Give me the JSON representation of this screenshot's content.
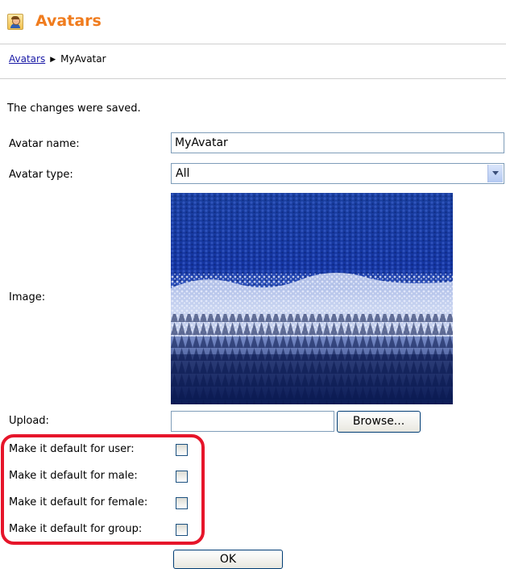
{
  "header": {
    "title": "Avatars",
    "icon": "avatar-icon"
  },
  "breadcrumb": {
    "root": "Avatars",
    "current": "MyAvatar"
  },
  "message": "The changes were saved.",
  "form": {
    "name_label": "Avatar name:",
    "name_value": "MyAvatar",
    "type_label": "Avatar type:",
    "type_value": "All",
    "image_label": "Image:",
    "upload_label": "Upload:",
    "upload_value": "",
    "browse_label": "Browse...",
    "defaults": [
      {
        "label": "Make it default for user:",
        "checked": false
      },
      {
        "label": "Make it default for male:",
        "checked": false
      },
      {
        "label": "Make it default for female:",
        "checked": false
      },
      {
        "label": "Make it default for group:",
        "checked": false
      }
    ],
    "ok_label": "OK"
  },
  "colors": {
    "title": "#f07c1e",
    "highlight": "#e6152a",
    "link": "#1a1aa6"
  }
}
